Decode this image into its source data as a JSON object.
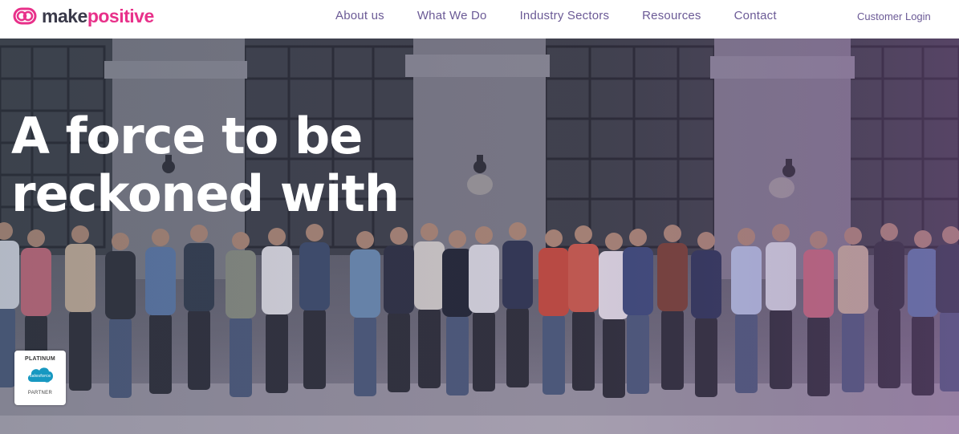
{
  "brand": {
    "name_part1": "make",
    "name_part2": "positive",
    "logo_icon": "double-ring-logo-icon",
    "accent": "#e8318a"
  },
  "nav": {
    "items": [
      {
        "label": "About us"
      },
      {
        "label": "What We Do"
      },
      {
        "label": "Industry Sectors"
      },
      {
        "label": "Resources"
      },
      {
        "label": "Contact"
      }
    ],
    "login": "Customer Login",
    "color": "#6b5a96"
  },
  "hero": {
    "title_line1": "A force to be",
    "title_line2": "reckoned with",
    "image": "team-group-photo"
  },
  "badge": {
    "top": "PLATINUM",
    "logo_text": "salesforce",
    "bottom": "PARTNER",
    "logo_color": "#1798c1"
  }
}
